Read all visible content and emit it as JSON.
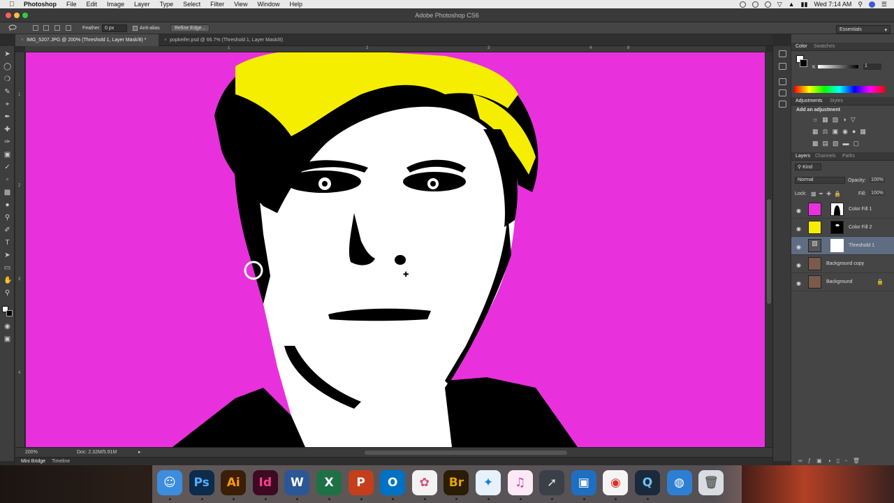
{
  "menubar": {
    "app_name": "Photoshop",
    "items": [
      "File",
      "Edit",
      "Image",
      "Layer",
      "Type",
      "Select",
      "Filter",
      "View",
      "Window",
      "Help"
    ],
    "clock": "Wed 7:14 AM"
  },
  "window": {
    "title": "Adobe Photoshop CS6"
  },
  "options_bar": {
    "feather_label": "Feather:",
    "feather_value": "0 px",
    "anti_alias_label": "Anti-alias",
    "refine_edge_label": "Refine Edge..."
  },
  "workspace": {
    "selected": "Essentials"
  },
  "doc_tabs": [
    {
      "label": "IMG_5207.JPG @ 200% (Threshold 1, Layer Mask/8) *",
      "active": true
    },
    {
      "label": "popkeifer.psd @ 66.7% (Threshold 1, Layer Mask/8)",
      "active": false
    }
  ],
  "rulers": {
    "h_ticks": [
      "1",
      "2",
      "3",
      "4",
      "8"
    ],
    "v_ticks": [
      "1",
      "2",
      "3",
      "4"
    ]
  },
  "status_bar": {
    "zoom": "200%",
    "doc_size": "Doc: 2.32M/5.91M"
  },
  "bottom_panels": {
    "mini_bridge": "Mini Bridge",
    "timeline": "Timeline"
  },
  "color_panel": {
    "tabs": [
      "Color",
      "Swatches"
    ],
    "k_label": "K",
    "k_value": "1"
  },
  "adjustments_panel": {
    "tabs": [
      "Adjustments",
      "Styles"
    ],
    "heading": "Add an adjustment"
  },
  "layers_panel": {
    "tabs": [
      "Layers",
      "Channels",
      "Paths"
    ],
    "kind_filter": "Kind",
    "blend_mode": "Normal",
    "opacity_label": "Opacity:",
    "opacity_value": "100%",
    "lock_label": "Lock:",
    "fill_label": "Fill:",
    "fill_value": "100%",
    "layers": [
      {
        "name": "Color Fill 1",
        "swatch": "#e831dc",
        "selected": false
      },
      {
        "name": "Color Fill 2",
        "swatch": "#f5ee00",
        "selected": false
      },
      {
        "name": "Threshold 1",
        "swatch": "#ffffff",
        "selected": true
      },
      {
        "name": "Background copy",
        "swatch": "#7a5a4a",
        "selected": false
      },
      {
        "name": "Background",
        "swatch": "#7a5a4a",
        "selected": false
      }
    ]
  },
  "colors": {
    "canvas_magenta": "#e831dc",
    "hair_yellow": "#f5ee00",
    "layer_selected": "#5f6d83"
  },
  "dock": {
    "apps": [
      {
        "name": "Finder",
        "glyph": "☺",
        "bg": "#3c8de0",
        "fg": "#ffffff"
      },
      {
        "name": "Photoshop",
        "glyph": "Ps",
        "bg": "#0d2b4a",
        "fg": "#4fb1ff"
      },
      {
        "name": "Illustrator",
        "glyph": "Ai",
        "bg": "#3a1f06",
        "fg": "#ff9a00"
      },
      {
        "name": "InDesign",
        "glyph": "Id",
        "bg": "#3d0a22",
        "fg": "#ff3f8e"
      },
      {
        "name": "Word",
        "glyph": "W",
        "bg": "#2b5797",
        "fg": "#ffffff"
      },
      {
        "name": "Excel",
        "glyph": "X",
        "bg": "#1e7145",
        "fg": "#ffffff"
      },
      {
        "name": "PowerPoint",
        "glyph": "P",
        "bg": "#c43e1c",
        "fg": "#ffffff"
      },
      {
        "name": "Outlook",
        "glyph": "O",
        "bg": "#0072c6",
        "fg": "#ffffff"
      },
      {
        "name": "Photos",
        "glyph": "✿",
        "bg": "#f2f2f2",
        "fg": "#e04a7a"
      },
      {
        "name": "Bridge",
        "glyph": "Br",
        "bg": "#2a1c05",
        "fg": "#e8a100"
      },
      {
        "name": "Safari",
        "glyph": "✦",
        "bg": "#e6f1fb",
        "fg": "#1c7ed6"
      },
      {
        "name": "iTunes",
        "glyph": "♫",
        "bg": "#fbe9f5",
        "fg": "#d63aa8"
      },
      {
        "name": "Launchpad",
        "glyph": "➚",
        "bg": "#3a3f48",
        "fg": "#dddddd"
      },
      {
        "name": "Preview",
        "glyph": "▣",
        "bg": "#1e6fc2",
        "fg": "#ffffff"
      },
      {
        "name": "Chrome",
        "glyph": "◉",
        "bg": "#f4f4f4",
        "fg": "#d93025"
      },
      {
        "name": "QuickTime",
        "glyph": "Q",
        "bg": "#1b2a3a",
        "fg": "#6ec1ff"
      },
      {
        "name": "Network",
        "glyph": "◍",
        "bg": "#2d7fd3",
        "fg": "#ffffff"
      },
      {
        "name": "Trash",
        "glyph": "🗑",
        "bg": "#d9dde2",
        "fg": "#666666"
      }
    ]
  }
}
